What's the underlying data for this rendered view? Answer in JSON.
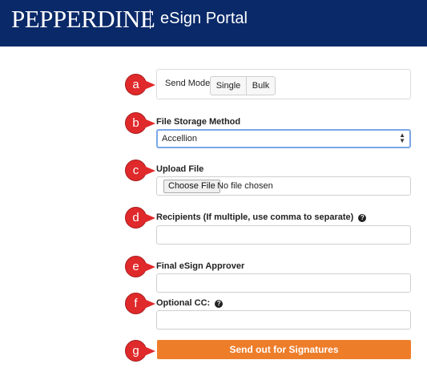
{
  "header": {
    "logo": "PEPPERDINE",
    "title": "eSign Portal"
  },
  "markers": [
    "a",
    "b",
    "c",
    "d",
    "e",
    "f",
    "g"
  ],
  "send_mode": {
    "label": "Send Mode:",
    "options": [
      "Single",
      "Bulk"
    ]
  },
  "file_storage": {
    "label": "File Storage Method",
    "selected": "Accellion"
  },
  "upload": {
    "label": "Upload File",
    "button": "Choose File",
    "status": "No file chosen"
  },
  "recipients": {
    "label": "Recipients (If multiple, use comma to separate)",
    "help": "?"
  },
  "approver": {
    "label": "Final eSign Approver"
  },
  "cc": {
    "label": "Optional CC:",
    "help": "?"
  },
  "submit": {
    "label": "Send out for Signatures"
  },
  "colors": {
    "header_bg": "#0a2969",
    "marker_red": "#e0292b",
    "submit_orange": "#ee7d2a",
    "select_focus": "#7aa7e8"
  }
}
